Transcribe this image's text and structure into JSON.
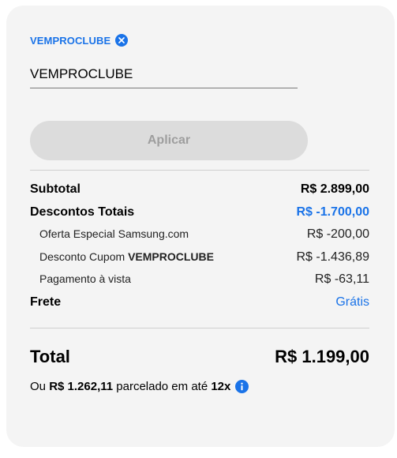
{
  "coupon": {
    "applied_code": "VEMPROCLUBE",
    "input_value": "VEMPROCLUBE",
    "apply_label": "Aplicar"
  },
  "summary": {
    "subtotal": {
      "label": "Subtotal",
      "value": "R$ 2.899,00"
    },
    "discounts_total": {
      "label": "Descontos Totais",
      "value": "R$ -1.700,00"
    },
    "discount_items": [
      {
        "label": "Oferta Especial Samsung.com",
        "value": "R$ -200,00"
      },
      {
        "label_prefix": "Desconto Cupom ",
        "label_code": "VEMPROCLUBE",
        "value": "R$ -1.436,89"
      },
      {
        "label": "Pagamento à vista",
        "value": "R$ -63,11"
      }
    ],
    "shipping": {
      "label": "Frete",
      "value": "Grátis"
    },
    "total": {
      "label": "Total",
      "value": "R$ 1.199,00"
    },
    "installment": {
      "prefix": "Ou ",
      "amount": "R$ 1.262,11",
      "middle": " parcelado em até ",
      "count": "12x"
    }
  },
  "colors": {
    "accent": "#1a73e8",
    "card_background": "#f4f4f4",
    "disabled_button": "#dcdcdc"
  },
  "icons": {
    "chip_remove": "close-icon",
    "installment_info": "info-icon"
  }
}
